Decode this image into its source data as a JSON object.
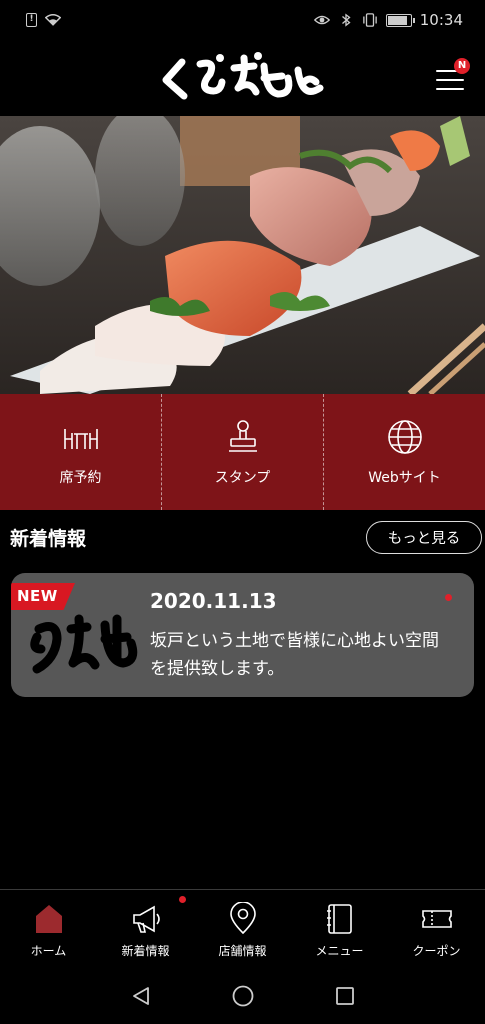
{
  "status_bar": {
    "time": "10:34",
    "sim_label": "!",
    "battery_level": 0.8,
    "left_icons": [
      "sim-alert-icon",
      "wifi-icon"
    ],
    "right_icons": [
      "eye-icon",
      "bluetooth-icon",
      "vibrate-icon",
      "battery-icon"
    ]
  },
  "header": {
    "logo_alt": "くろえもん",
    "menu_badge": "N"
  },
  "actions": [
    {
      "label": "席予約",
      "icon": "table-chairs-icon"
    },
    {
      "label": "スタンプ",
      "icon": "stamp-icon"
    },
    {
      "label": "Webサイト",
      "icon": "globe-icon"
    }
  ],
  "news": {
    "section_title": "新着情報",
    "more_label": "もっと見る",
    "items": [
      {
        "badge": "NEW",
        "date": "2020.11.13",
        "text": "坂戸という土地で皆様に心地よい空間を提供致します。",
        "unread": true
      }
    ]
  },
  "bottom_nav": [
    {
      "label": "ホーム",
      "icon": "home-icon",
      "active": true
    },
    {
      "label": "新着情報",
      "icon": "megaphone-icon",
      "badge": true
    },
    {
      "label": "店舗情報",
      "icon": "map-pin-icon"
    },
    {
      "label": "メニュー",
      "icon": "menu-book-icon"
    },
    {
      "label": "クーポン",
      "icon": "ticket-icon"
    }
  ],
  "system_nav": [
    "back-icon",
    "home-circle-icon",
    "recents-icon"
  ],
  "colors": {
    "accent_red": "#7e1418",
    "badge_red": "#d81822",
    "card_bg": "#575757",
    "home_icon_red": "#9c2a2e"
  }
}
